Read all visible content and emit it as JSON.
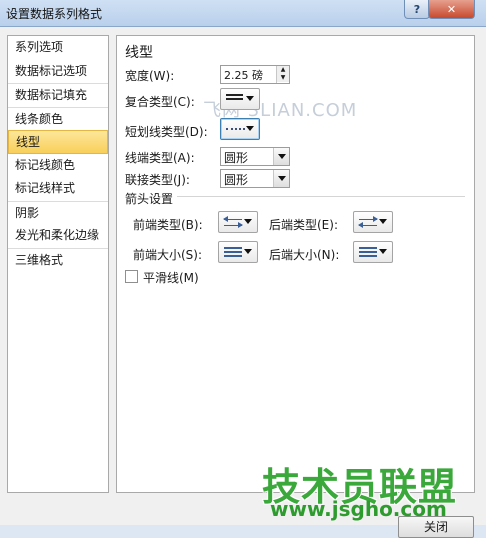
{
  "window": {
    "title": "设置数据系列格式",
    "help_label": "?",
    "close_label": "✕"
  },
  "sidebar": {
    "items": [
      {
        "label": "系列选项"
      },
      {
        "label": "数据标记选项"
      },
      {
        "label": "数据标记填充"
      },
      {
        "label": "线条颜色"
      },
      {
        "label": "线型"
      },
      {
        "label": "标记线颜色"
      },
      {
        "label": "标记线样式"
      },
      {
        "label": "阴影"
      },
      {
        "label": "发光和柔化边缘"
      },
      {
        "label": "三维格式"
      }
    ],
    "active_index": 4
  },
  "line_style": {
    "heading": "线型",
    "width_label": "宽度(W):",
    "width_value": "2.25 磅",
    "compound_label": "复合类型(C):",
    "dash_label": "短划线类型(D):",
    "cap_label": "线端类型(A):",
    "cap_value": "圆形",
    "join_label": "联接类型(J):",
    "join_value": "圆形",
    "arrow_section": "箭头设置",
    "begin_type_label": "前端类型(B):",
    "end_type_label": "后端类型(E):",
    "begin_size_label": "前端大小(S):",
    "end_size_label": "后端大小(N):",
    "smooth_label": "平滑线(M)"
  },
  "footer": {
    "close_label": "关闭"
  },
  "watermarks": {
    "top": "飞网 3LIAN.COM",
    "logo": "技术员联盟",
    "url": "www.jsgho.com"
  }
}
